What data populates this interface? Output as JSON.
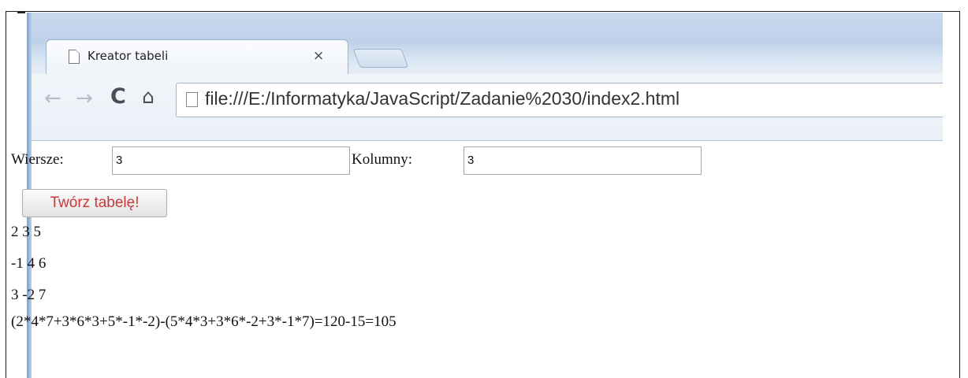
{
  "browser": {
    "tab_title": "Kreator tabeli",
    "tab_close": "×",
    "url": "file:///E:/Informatyka/JavaScript/Zadanie%2030/index2.html",
    "nav": {
      "back": "←",
      "forward": "→",
      "reload": "C",
      "home": "⌂"
    }
  },
  "form": {
    "rows_label": "Wiersze:",
    "rows_value": "3",
    "cols_label": "Kolumny:",
    "cols_value": "3",
    "create_button": "Twórz tabelę!"
  },
  "output": {
    "lines": [
      "2 3 5",
      "-1 4 6",
      "3 -2 7"
    ],
    "result": "(2*4*7+3*6*3+5*-1*-2)-(5*4*3+3*6*-2+3*-1*7)=120-15=105"
  },
  "colors": {
    "button_text": "#c9373a",
    "titlebar": "#bdd1ea"
  }
}
